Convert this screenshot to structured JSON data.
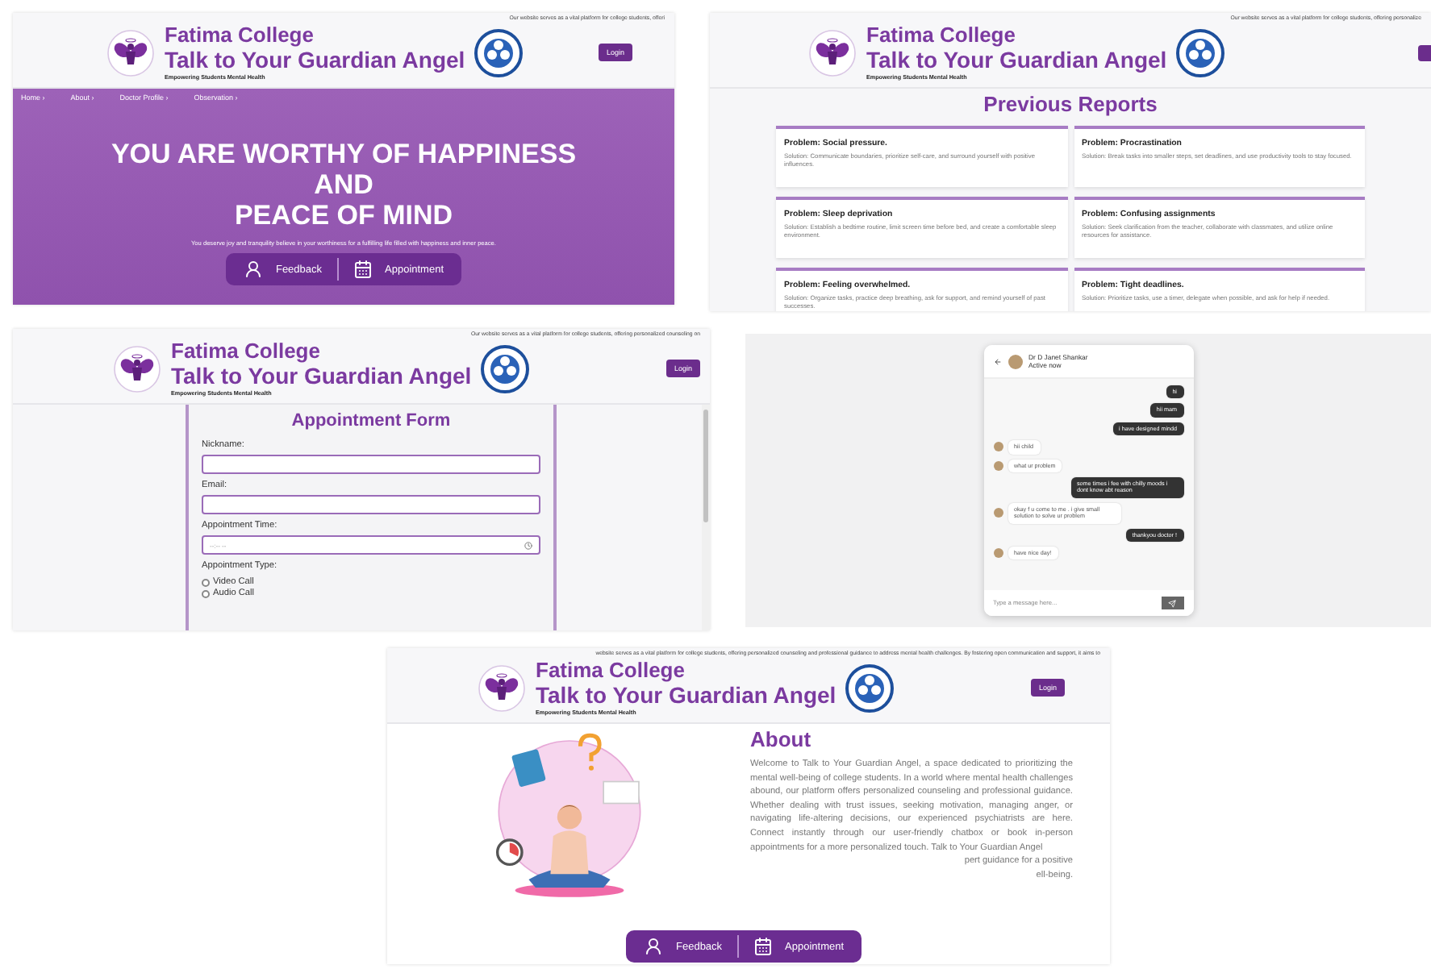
{
  "panels": [
    {
      "kind": "home",
      "header": {
        "marquee": "Our website serves as a vital platform for college students, offeri",
        "college": "Fatima College",
        "title": "Talk to Your Guardian Angel",
        "tagline": "Empowering Students Mental Health",
        "login": "Login"
      },
      "nav": [
        "Home ›",
        "About ›",
        "Doctor Profile ›",
        "Observation ›"
      ],
      "hero_lines": [
        "YOU ARE WORTHY OF HAPPINESS",
        "AND",
        "PEACE OF MIND"
      ],
      "subtitle": "You deserve joy and tranquility believe in your worthiness for a fulfilling life filled with happiness and inner peace.",
      "actions": [
        "Feedback",
        "Appointment"
      ]
    },
    {
      "kind": "reports",
      "header": {
        "marquee": "Our website serves as a vital platform for college students, offering personalize",
        "college": "Fatima College",
        "title": "Talk to Your Guardian Angel",
        "tagline": "Empowering Students Mental Health"
      },
      "heading": "Previous Reports",
      "reports": [
        {
          "problem": "Problem: Social pressure.",
          "solution": "Solution: Communicate boundaries, prioritize self-care, and surround yourself with positive influences."
        },
        {
          "problem": "Problem: Procrastination",
          "solution": "Solution: Break tasks into smaller steps, set deadlines, and use productivity tools to stay focused."
        },
        {
          "problem": "Problem: Sleep deprivation",
          "solution": "Solution: Establish a bedtime routine, limit screen time before bed, and create a comfortable sleep environment."
        },
        {
          "problem": "Problem: Confusing assignments",
          "solution": "Solution: Seek clarification from the teacher, collaborate with classmates, and utilize online resources for assistance."
        },
        {
          "problem": "Problem: Feeling overwhelmed.",
          "solution": "Solution: Organize tasks, practice deep breathing, ask for support, and remind yourself of past successes."
        },
        {
          "problem": "Problem: Tight deadlines.",
          "solution": "Solution: Prioritize tasks, use a timer, delegate when possible, and ask for help if needed."
        }
      ]
    },
    {
      "kind": "form",
      "header": {
        "marquee": "Our website serves as a vital platform for college students, offering personalized counseling on",
        "college": "Fatima College",
        "title": "Talk to Your Guardian Angel",
        "tagline": "Empowering Students Mental Health",
        "login": "Login"
      },
      "heading": "Appointment Form",
      "fields": [
        {
          "label": "Nickname:",
          "kind": "text"
        },
        {
          "label": "Email:",
          "kind": "text"
        },
        {
          "label": "Appointment Time:",
          "kind": "time",
          "placeholder": "--:-- --"
        }
      ],
      "type_label": "Appointment Type:",
      "options": [
        {
          "label": "Video Call",
          "selected": false
        },
        {
          "label": "Audio Call",
          "selected": false
        }
      ]
    },
    {
      "kind": "chat",
      "contact": "Dr D Janet Shankar",
      "status": "Active now",
      "messages": [
        {
          "kind": "sent",
          "text": "hi"
        },
        {
          "kind": "sent",
          "text": "hii mam"
        },
        {
          "kind": "sent",
          "text": "i have designed mindd"
        },
        {
          "kind": "received",
          "text": "hii child"
        },
        {
          "kind": "received",
          "text": "what ur problem"
        },
        {
          "kind": "sent",
          "text": "some times i fee with chilly moods i dont know abt reason"
        },
        {
          "kind": "received",
          "text": "okay f u come to me . i give small solution to solve ur problem"
        },
        {
          "kind": "sent",
          "text": "thankyou doctor !"
        },
        {
          "kind": "received",
          "text": "have nice day!"
        }
      ],
      "input_placeholder": "Type a message here..."
    },
    {
      "kind": "about",
      "header": {
        "marquee": "website serves as a vital platform for college students, offering personalized counseling and professional guidance to address mental health challenges. By fostering open communication and support, it aims to",
        "college": "Fatima College",
        "title": "Talk to Your Guardian Angel",
        "tagline": "Empowering Students Mental Health",
        "login": "Login"
      },
      "heading": "About",
      "paragraph": "Welcome to Talk to Your Guardian Angel, a space dedicated to prioritizing the mental well-being of college students. In a world where mental health challenges abound, our platform offers personalized counseling and professional guidance. Whether dealing with trust issues, seeking motivation, managing anger, or navigating life-altering decisions, our experienced psychiatrists are here. Connect instantly through our user-friendly chatbox or book in-person appointments for a more personalized touch. Talk to Your Guardian Angel",
      "tail_lines": [
        "pert guidance for a positive",
        "ell-being."
      ],
      "actions": [
        "Feedback",
        "Appointment"
      ]
    }
  ]
}
